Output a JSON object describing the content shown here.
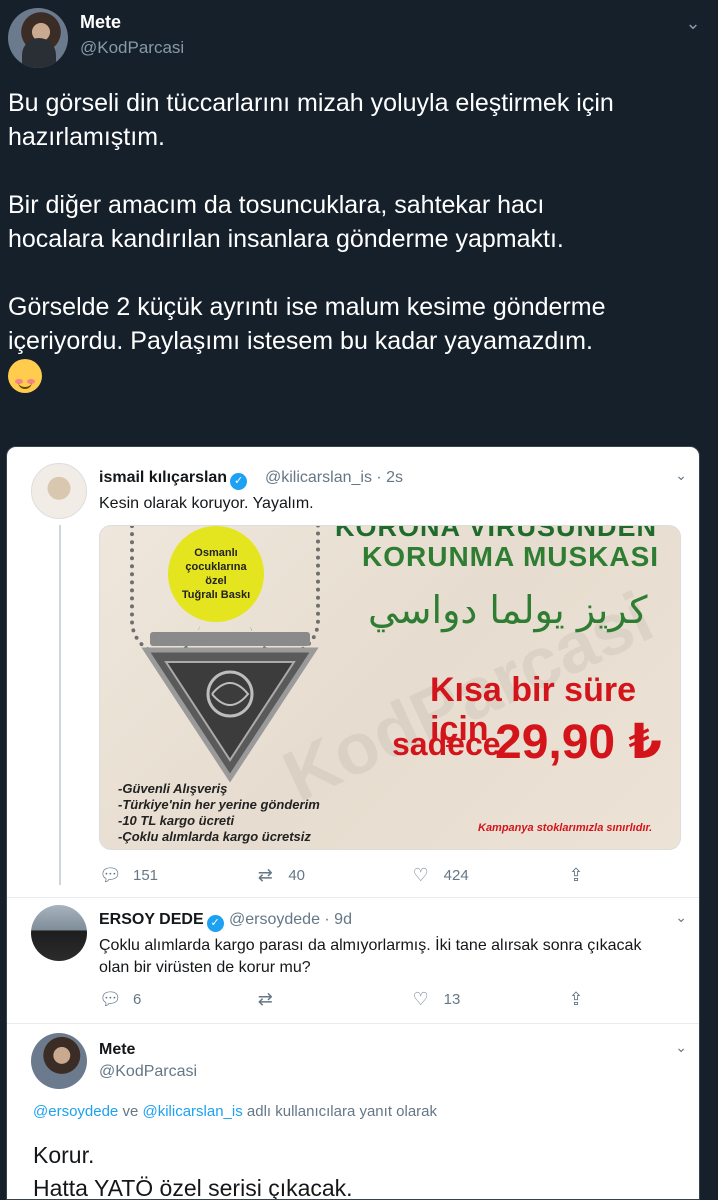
{
  "outer": {
    "name": "Mete",
    "handle": "@KodParcasi",
    "text": "Bu görseli din tüccarlarını mizah yoluyla eleştirmek için\nhazırlamıştım.\n\nBir diğer amacım da tosuncuklara, sahtekar hacı\nhocalara kandırılan insanlara gönderme yapmaktı.\n\nGörselde 2 küçük ayrıntı ise malum kesime gönderme\niçeriyordu. Paylaşımı istesem bu kadar yayamazdım.\n"
  },
  "tweet1": {
    "name": "ismail kılıçarslan",
    "meta": "@kilicarslan_is · 2s",
    "body": "Kesin olarak koruyor. Yayalım.",
    "replies": "151",
    "retweets": "40",
    "likes": "424"
  },
  "product": {
    "head": "KORONA VİRÜSÜNDEN",
    "title": "KORUNMA MUSKASI",
    "arabic": "كريز يولما دواسي",
    "badge_line1": "Osmanlı",
    "badge_line2": "çocuklarına",
    "badge_line3": "özel",
    "badge_line4": "Tuğralı Baskı",
    "kisa": "Kısa bir süre için",
    "sadece": "sadece",
    "price": "29,90 ₺",
    "feature1": "-Güvenli Alışveriş",
    "feature2": "-Türkiye'nin her yerine gönderim",
    "feature3": "-10 TL kargo ücreti",
    "feature4": "-Çoklu alımlarda kargo ücretsiz",
    "kampanya": "Kampanya stoklarımızla sınırlıdır.",
    "watermark": "KodParcasi"
  },
  "tweet2": {
    "name": "ERSOY DEDE",
    "meta": "@ersoydede · 9d",
    "body": "Çoklu alımlarda kargo parası da almıyorlarmış. İki tane alırsak sonra çıkacak olan bir virüsten de korur mu?",
    "replies": "6",
    "retweets": "",
    "likes": "13"
  },
  "tweet3": {
    "name": "Mete",
    "handle": "@KodParcasi",
    "reply_mention1": "@ersoydede",
    "reply_ve": " ve ",
    "reply_mention2": "@kilicarslan_is",
    "reply_suffix": " adlı kullanıcılara yanıt olarak",
    "text": "Korur.\nHatta YATÖ özel serisi çıkacak."
  },
  "colors": {
    "bg_dark": "#15202b",
    "accent": "#1da1f2",
    "price_red": "#d3151b",
    "title_green": "#2e7d32"
  }
}
